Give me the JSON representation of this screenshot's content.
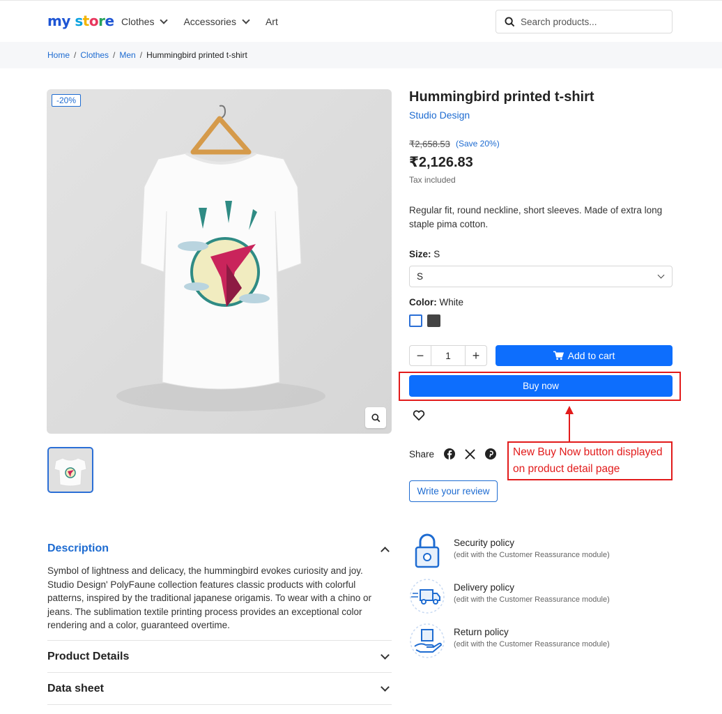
{
  "header": {
    "logo": {
      "my": "my",
      "s": "s",
      "t": "t",
      "o": "o",
      "r": "r",
      "e": "e"
    },
    "nav": [
      {
        "label": "Clothes",
        "has_dropdown": true
      },
      {
        "label": "Accessories",
        "has_dropdown": true
      },
      {
        "label": "Art",
        "has_dropdown": false
      }
    ],
    "search_placeholder": "Search products..."
  },
  "breadcrumb": {
    "items": [
      "Home",
      "Clothes",
      "Men"
    ],
    "separator": "/",
    "current": "Hummingbird printed t-shirt"
  },
  "product": {
    "discount_badge": "-20%",
    "title": "Hummingbird printed t-shirt",
    "brand": "Studio Design",
    "old_price": "₹2,658.53",
    "save_text": "(Save 20%)",
    "price": "₹2,126.83",
    "tax_note": "Tax included",
    "short_description": "Regular fit, round neckline, short sleeves. Made of extra long staple pima cotton.",
    "size_label": "Size",
    "size_value": "S",
    "size_selected": "S",
    "color_label": "Color",
    "color_value": "White",
    "colors": [
      "#ffffff",
      "#444444"
    ],
    "quantity": "1",
    "qty_minus": "−",
    "qty_plus": "+",
    "add_to_cart": "Add to cart",
    "buy_now": "Buy now",
    "share_label": "Share",
    "review_button": "Write your review"
  },
  "annotation": {
    "text": "New Buy Now button displayed on product detail page",
    "color": "#e21b1b"
  },
  "accordion": {
    "description_title": "Description",
    "description_body": "Symbol of lightness and delicacy, the hummingbird evokes curiosity and joy. Studio Design' PolyFaune collection features classic products with colorful patterns, inspired by the traditional japanese origamis. To wear with a chino or jeans. The sublimation textile printing process provides an exceptional color rendering and a color, guaranteed overtime.",
    "product_details_title": "Product Details",
    "data_sheet_title": "Data sheet"
  },
  "reassurance": [
    {
      "title": "Security policy",
      "subtitle": "(edit with the Customer Reassurance module)",
      "icon": "lock-icon"
    },
    {
      "title": "Delivery policy",
      "subtitle": "(edit with the Customer Reassurance module)",
      "icon": "delivery-truck-icon"
    },
    {
      "title": "Return policy",
      "subtitle": "(edit with the Customer Reassurance module)",
      "icon": "return-box-icon"
    }
  ],
  "colors": {
    "accent": "#0d6efd",
    "link": "#1d6bd1",
    "annotation": "#e21b1b"
  }
}
